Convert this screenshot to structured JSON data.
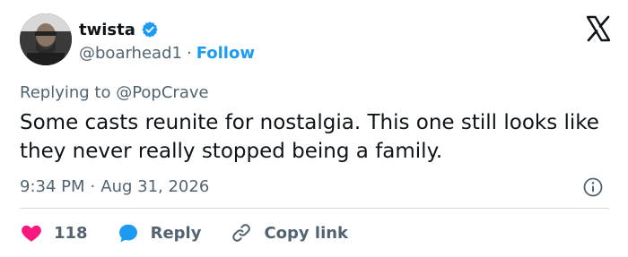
{
  "author": {
    "display_name": "twista",
    "handle": "@boarhead1",
    "separator": "·",
    "follow_label": "Follow"
  },
  "tweet": {
    "replying_prefix": "Replying to ",
    "replying_to": "@PopCrave",
    "text": "Some casts reunite for nostalgia. This one still looks like they never really stopped being a family.",
    "time": "9:34 PM",
    "meta_separator": "·",
    "date": "Aug 31, 2026"
  },
  "actions": {
    "like_count": "118",
    "reply_label": "Reply",
    "copy_label": "Copy link"
  },
  "colors": {
    "accent": "#1d9bf0",
    "like": "#f91880",
    "muted": "#536471",
    "text": "#0f1419"
  },
  "icons": {
    "verified": "verified-badge-icon",
    "logo": "x-logo-icon",
    "info": "info-icon",
    "like": "heart-icon",
    "reply": "speech-bubble-icon",
    "copy": "link-icon"
  }
}
